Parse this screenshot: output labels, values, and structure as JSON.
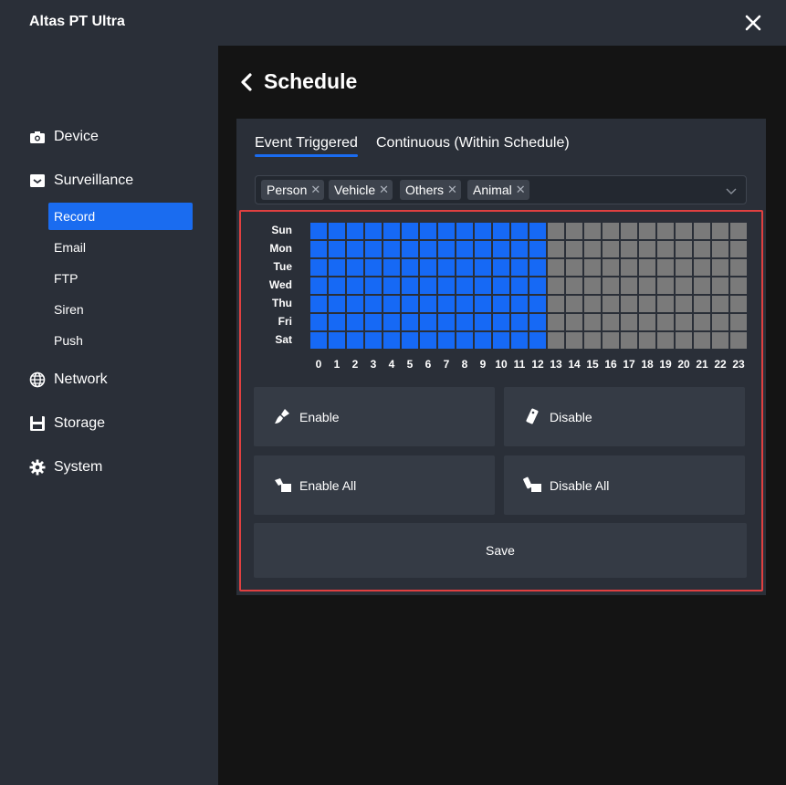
{
  "window": {
    "title": "Altas PT Ultra"
  },
  "sidebar": {
    "items": [
      {
        "label": "Device"
      },
      {
        "label": "Surveillance"
      },
      {
        "label": "Network"
      },
      {
        "label": "Storage"
      },
      {
        "label": "System"
      }
    ],
    "sub_items": [
      {
        "label": "Record",
        "active": true
      },
      {
        "label": "Email"
      },
      {
        "label": "FTP"
      },
      {
        "label": "Siren"
      },
      {
        "label": "Push"
      }
    ]
  },
  "main": {
    "title": "Schedule",
    "tabs": [
      {
        "label": "Event Triggered",
        "active": true
      },
      {
        "label": "Continuous (Within Schedule)"
      }
    ],
    "filter_chips": [
      "Person",
      "Vehicle",
      "Others",
      "Animal"
    ],
    "schedule": {
      "days": [
        "Sun",
        "Mon",
        "Tue",
        "Wed",
        "Thu",
        "Fri",
        "Sat"
      ],
      "hours": [
        "0",
        "1",
        "2",
        "3",
        "4",
        "5",
        "6",
        "7",
        "8",
        "9",
        "10",
        "11",
        "12",
        "13",
        "14",
        "15",
        "16",
        "17",
        "18",
        "19",
        "20",
        "21",
        "22",
        "23"
      ],
      "enabled_hours_per_day": 13
    },
    "buttons": {
      "enable": "Enable",
      "disable": "Disable",
      "enable_all": "Enable All",
      "disable_all": "Disable All",
      "save": "Save"
    }
  },
  "colors": {
    "accent": "#1a6cf0",
    "cell_on": "#1669f5",
    "cell_off": "#7a7a7a",
    "highlight_border": "#e04040"
  }
}
